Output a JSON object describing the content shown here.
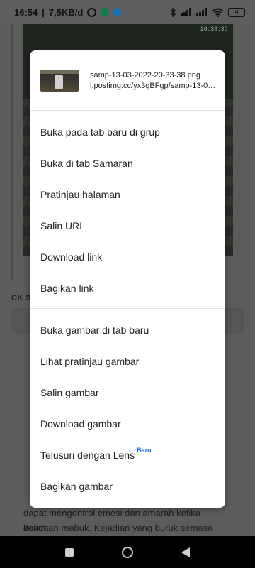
{
  "status_bar": {
    "time": "16:54",
    "net_speed": "7,5KB/d",
    "battery": "4"
  },
  "background_page": {
    "image_clock": "20:33:38",
    "section_label": "CK S",
    "text_line_1": "dapat mengontrol emosi dan amarah ketika dalam",
    "text_line_2": "keadaan mabuk. Kejadian yang buruk semasa kecil"
  },
  "context_menu": {
    "header": {
      "file_name": "samp-13-03-2022-20-33-38.png",
      "url": "i.postimg.cc/yx3gBFgp/samp-13-03-2022-20-33-38.png"
    },
    "link_items": [
      "Buka pada tab baru di grup",
      "Buka di tab Samaran",
      "Pratinjau halaman",
      "Salin URL",
      "Download link",
      "Bagikan link"
    ],
    "image_items": [
      "Buka gambar di tab baru",
      "Lihat pratinjau gambar",
      "Salin gambar",
      "Download gambar"
    ],
    "lens_item": {
      "label": "Telusuri dengan Lens",
      "badge": "Baru"
    },
    "last_item": "Bagikan gambar"
  },
  "colors": {
    "scrim": "#5e5e5e",
    "menu_bg": "#ffffff",
    "badge": "#1a73e8"
  },
  "icons": {
    "status_left": [
      "alarm-icon",
      "app-icon",
      "telegram-icon"
    ],
    "status_right": [
      "bluetooth-icon",
      "signal-icon",
      "signal-icon",
      "wifi-icon",
      "battery-icon"
    ],
    "nav": [
      "recents-icon",
      "home-icon",
      "back-icon"
    ]
  }
}
